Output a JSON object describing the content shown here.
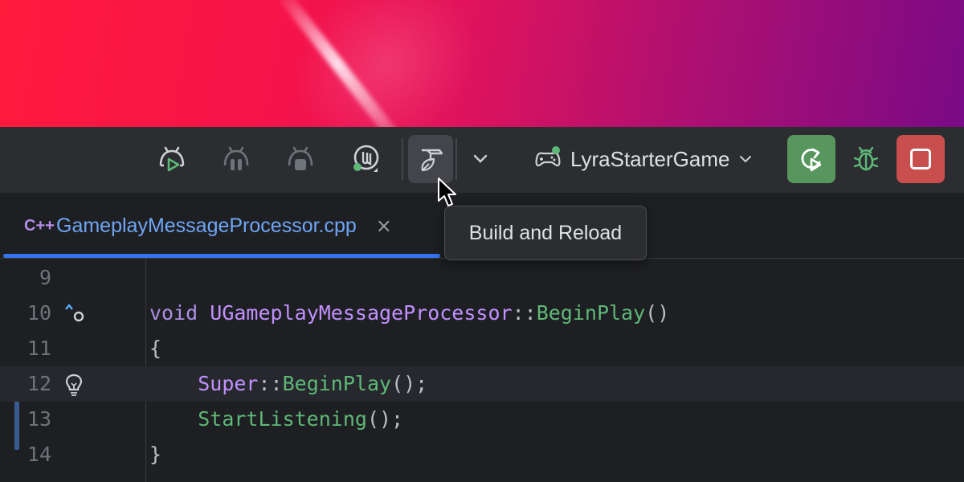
{
  "toolbar": {
    "buttons": [
      {
        "name": "run-android-icon"
      },
      {
        "name": "pause-android-icon"
      },
      {
        "name": "stop-android-icon"
      },
      {
        "name": "unreal-engine-icon"
      },
      {
        "name": "build-and-reload-icon"
      },
      {
        "name": "more-dropdown-icon"
      }
    ],
    "config_name": "LyraStarterGame",
    "run_color": "#57965c",
    "stop_color": "#c94f4f"
  },
  "tooltip": {
    "text": "Build and Reload"
  },
  "tab": {
    "file_icon": "C++",
    "file_name": "GameplayMessageProcessor.cpp",
    "close_glyph": "×",
    "accent": "#3574f0"
  },
  "editor": {
    "lines": [
      {
        "num": "9",
        "code": ""
      },
      {
        "num": "10",
        "code": "void UGameplayMessageProcessor::BeginPlay()"
      },
      {
        "num": "11",
        "code": "{"
      },
      {
        "num": "12",
        "code": "    Super::BeginPlay();"
      },
      {
        "num": "13",
        "code": "    StartListening();"
      },
      {
        "num": "14",
        "code": "}"
      }
    ]
  }
}
